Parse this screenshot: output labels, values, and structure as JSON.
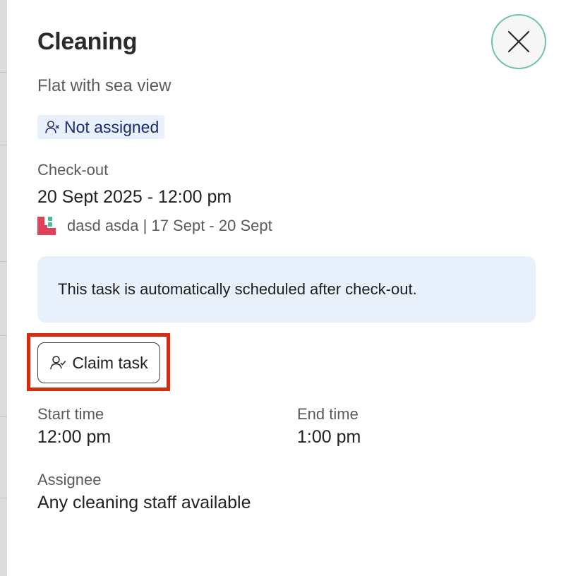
{
  "task": {
    "title": "Cleaning",
    "property": "Flat with sea view",
    "assignment_status": "Not assigned"
  },
  "checkout": {
    "label": "Check-out",
    "datetime": "20 Sept 2025 - 12:00 pm",
    "booking": "dasd asda | 17 Sept - 20 Sept"
  },
  "info": {
    "message": "This task is automatically scheduled after check-out."
  },
  "actions": {
    "claim_label": "Claim task",
    "close_icon": "close-icon"
  },
  "schedule": {
    "start_label": "Start time",
    "start_value": "12:00 pm",
    "end_label": "End time",
    "end_value": "1:00 pm"
  },
  "assignee": {
    "label": "Assignee",
    "value": "Any cleaning staff available"
  },
  "colors": {
    "accent_border": "#6cc4a1",
    "badge_bg": "#e8f1fb",
    "badge_text": "#1b2a6e",
    "highlight": "#d72a0e",
    "logo": "#e0415a"
  }
}
